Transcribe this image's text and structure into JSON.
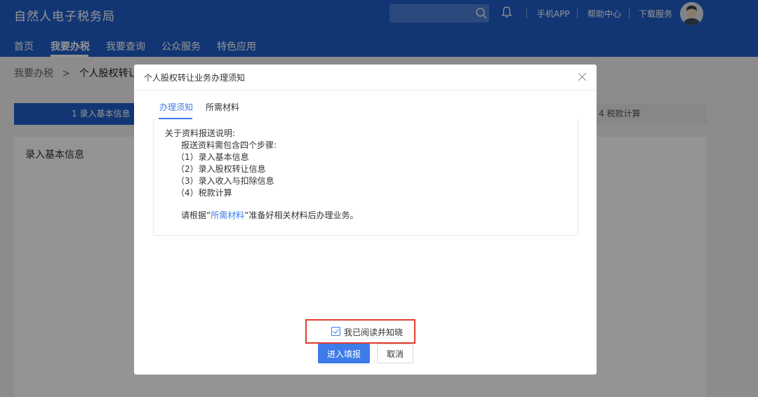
{
  "header": {
    "brand": "自然人电子税务局",
    "search": {
      "placeholder": ""
    },
    "links": [
      "手机APP",
      "帮助中心",
      "下载服务"
    ]
  },
  "nav": {
    "items": [
      "首页",
      "我要办税",
      "我要查询",
      "公众服务",
      "特色应用"
    ],
    "active_index": 1
  },
  "breadcrumb": {
    "root": "我要办税",
    "separator": ">",
    "current": "个人股权转让所"
  },
  "steps": {
    "step1": "1  录入基本信息",
    "step4": "4  税款计算"
  },
  "panel": {
    "title": "录入基本信息"
  },
  "modal": {
    "title": "个人股权转让业务办理须知",
    "tabs": [
      "办理须知",
      "所需材料"
    ],
    "active_tab": 0,
    "content": {
      "heading": "关于资料报送说明:",
      "intro": "报送资料需包含四个步骤:",
      "steps": [
        "（1）录入基本信息",
        "（2）录入股权转让信息",
        "（3）录入收入与扣除信息",
        "（4）税款计算"
      ],
      "note_prefix": "请根据“",
      "note_link": "所需材料",
      "note_suffix": "”准备好相关材料后办理业务。"
    },
    "confirm_checkbox": {
      "label": "我已阅读并知晓",
      "checked": true
    },
    "buttons": {
      "primary": "进入填报",
      "cancel": "取消"
    }
  },
  "colors": {
    "header_bg": "#1f5dc8",
    "accent": "#3d7ce8",
    "highlight_border": "#e23c2e"
  }
}
